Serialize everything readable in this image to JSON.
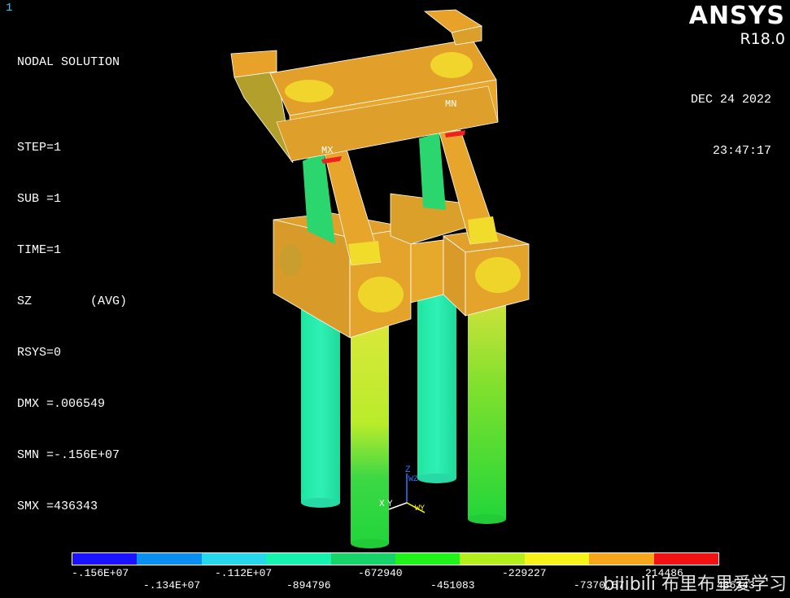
{
  "window_number": "1",
  "info_lines": [
    "NODAL SOLUTION",
    "",
    "STEP=1",
    "SUB =1",
    "TIME=1",
    "SZ        (AVG)",
    "RSYS=0",
    "DMX =.006549",
    "SMN =-.156E+07",
    "SMX =436343"
  ],
  "logo": {
    "brand": "ANSYS",
    "version": "R18.0"
  },
  "timestamp": {
    "date": "DEC 24 2022",
    "time": "23:47:17"
  },
  "markers": {
    "mx": "MX",
    "mn": "MN"
  },
  "triad": {
    "z": "Z",
    "wz": "WZ",
    "x": "X",
    "y": "Y",
    "wy": "WY"
  },
  "legend": {
    "colors": [
      "#1b12ff",
      "#0a8ef0",
      "#27d8ec",
      "#16f2b0",
      "#16d36a",
      "#20f21b",
      "#b2ef1c",
      "#f6f21a",
      "#f5a61a",
      "#f11313"
    ],
    "labels_top_row": [
      "-.156E+07",
      "-.112E+07",
      "-672940",
      "-229227",
      "214486"
    ],
    "labels_bottom_row": [
      "-.134E+07",
      "-894796",
      "-451083",
      "-7370.57",
      "436343"
    ]
  },
  "watermark": "bilibili 布里布里爱学习",
  "colors": {
    "background": "#000000",
    "structure_orange": "#e8a22a",
    "column_green": "#22d66b",
    "column_cyan": "#2ff0b5"
  }
}
